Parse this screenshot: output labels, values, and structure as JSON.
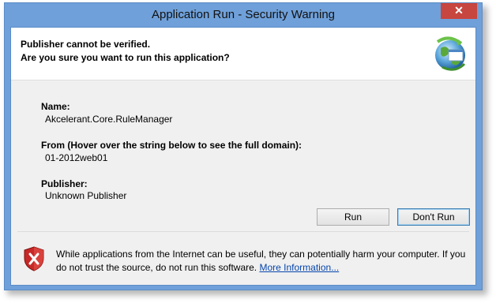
{
  "window": {
    "title": "Application Run - Security Warning",
    "close_glyph": "✕"
  },
  "header": {
    "line1": "Publisher cannot be verified.",
    "line2": "Are you sure you want to run this application?",
    "icon": "application-globe-icon"
  },
  "details": {
    "name_label": "Name:",
    "name_value": "Akcelerant.Core.RuleManager",
    "from_label": "From (Hover over the string below to see the full domain):",
    "from_value": "01-2012web01",
    "publisher_label": "Publisher:",
    "publisher_value": "Unknown Publisher"
  },
  "buttons": {
    "run": "Run",
    "dont_run": "Don't Run"
  },
  "footer": {
    "icon": "shield-warning-icon",
    "text": "While applications from the Internet can be useful, they can potentially harm your computer. If you do not trust the source, do not run this software.",
    "link": "More Information..."
  },
  "colors": {
    "titlebar": "#6fa0d9",
    "close_button": "#c7463f",
    "link": "#0645ad"
  }
}
